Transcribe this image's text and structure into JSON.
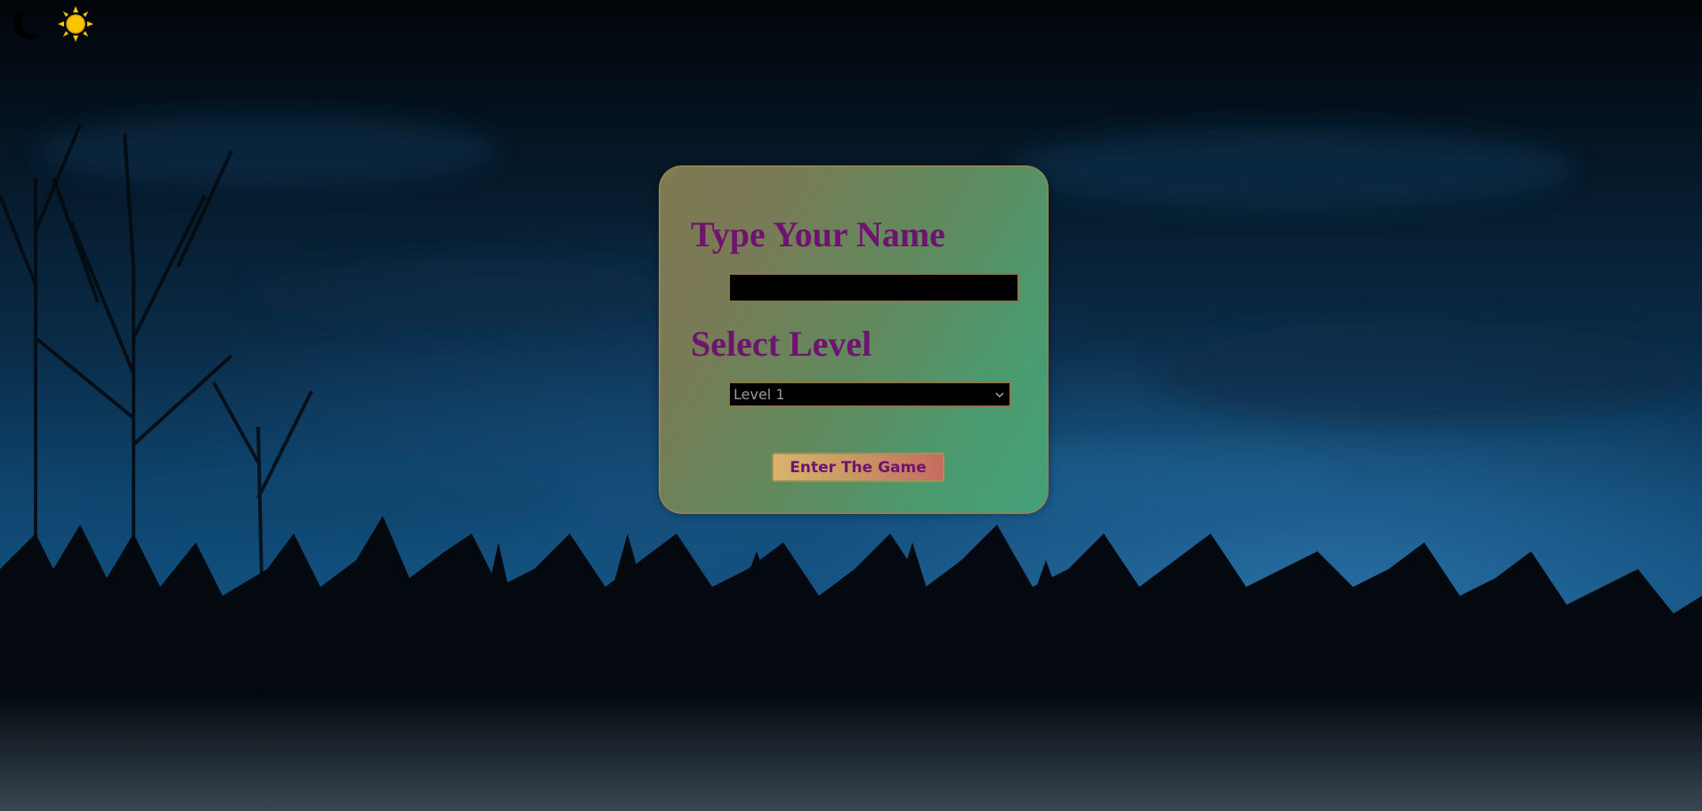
{
  "theme_toggle": {
    "moon_icon": "moon-icon",
    "sun_icon": "sun-icon"
  },
  "form": {
    "name_heading": "Type Your Name",
    "name_input_value": "",
    "level_heading": "Select Level",
    "level_selected": "Level 1",
    "enter_button_label": "Enter The Game"
  },
  "colors": {
    "heading": "#6e1470",
    "sun": "#f7c600",
    "card_border": "#96824f"
  }
}
